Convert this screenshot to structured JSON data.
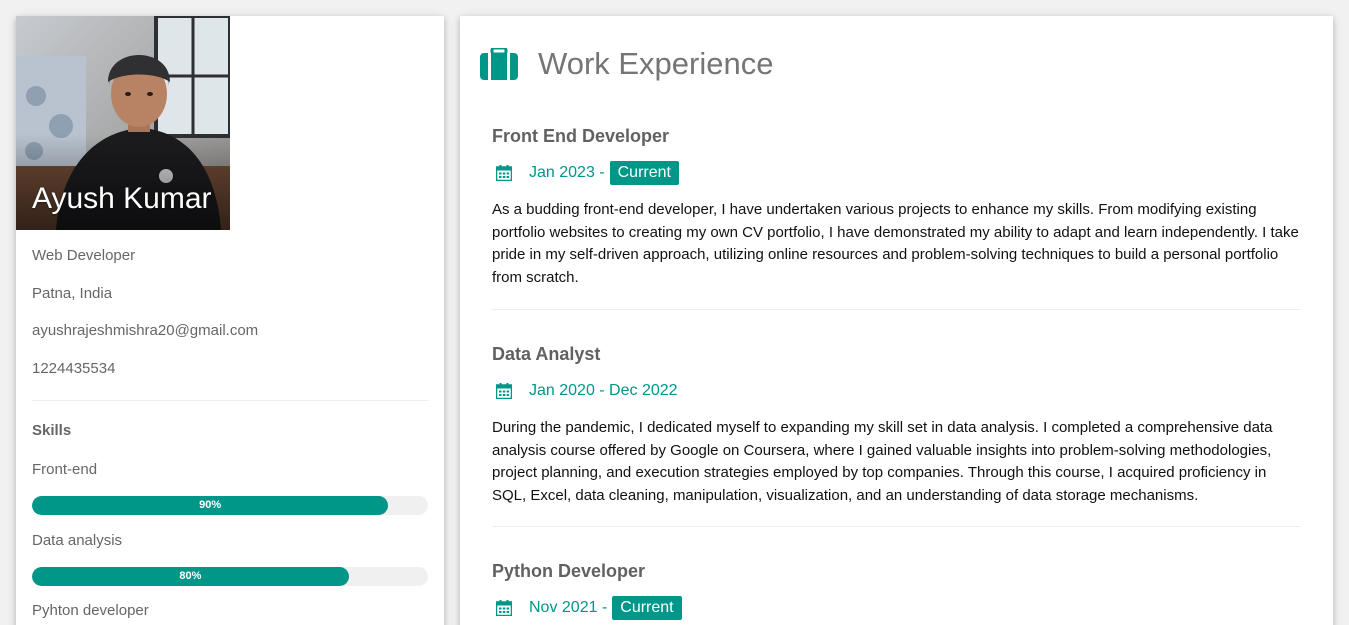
{
  "profile": {
    "name": "Ayush Kumar",
    "role": "Web Developer",
    "location": "Patna, India",
    "email": "ayushrajeshmishra20@gmail.com",
    "phone": "1224435534"
  },
  "skills": {
    "title": "Skills",
    "items": [
      {
        "label": "Front-end",
        "percent": 90,
        "percent_label": "90%"
      },
      {
        "label": "Data analysis",
        "percent": 80,
        "percent_label": "80%"
      },
      {
        "label": "Pyhton developer"
      }
    ]
  },
  "experience": {
    "title": "Work Experience",
    "icon": "briefcase-icon",
    "jobs": [
      {
        "title": "Front End Developer",
        "date": "Jan 2023 -",
        "badge": "Current",
        "description": "As a budding front-end developer, I have undertaken various projects to enhance my skills. From modifying existing portfolio websites to creating my own CV portfolio, I have demonstrated my ability to adapt and learn independently. I take pride in my self-driven approach, utilizing online resources and problem-solving techniques to build a personal portfolio from scratch."
      },
      {
        "title": "Data Analyst",
        "date": "Jan 2020 - Dec 2022",
        "badge": "",
        "description": "During the pandemic, I dedicated myself to expanding my skill set in data analysis. I completed a comprehensive data analysis course offered by Google on Coursera, where I gained valuable insights into problem-solving methodologies, project planning, and execution strategies employed by top companies. Through this course, I acquired proficiency in SQL, Excel, data cleaning, manipulation, visualization, and an understanding of data storage mechanisms."
      },
      {
        "title": "Python Developer",
        "date": "Nov 2021 -",
        "badge": "Current",
        "description": ""
      }
    ]
  },
  "colors": {
    "accent": "#009688",
    "muted_text": "#666666",
    "title_text": "#757575",
    "background": "#f1f1f1"
  }
}
